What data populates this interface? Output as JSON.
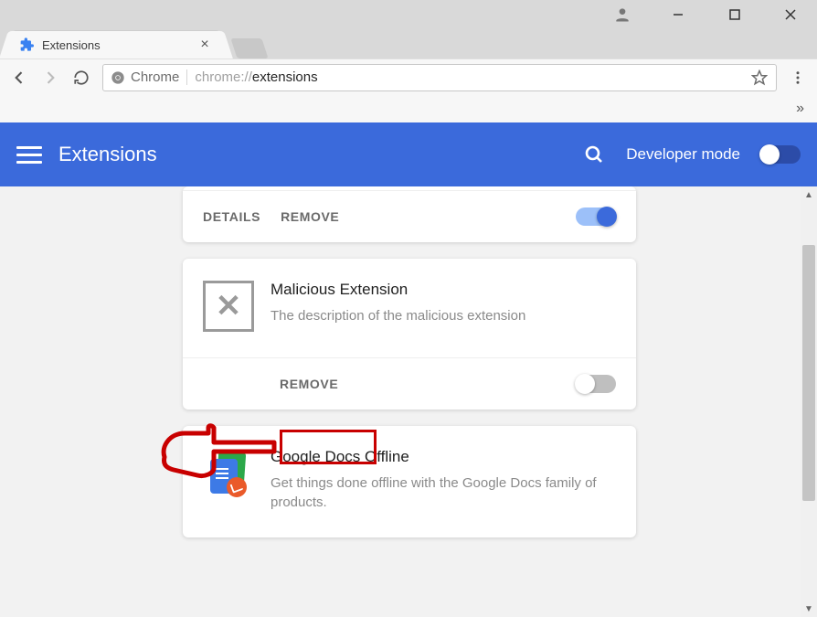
{
  "window": {
    "tab_title": "Extensions"
  },
  "toolbar": {
    "chrome_label": "Chrome",
    "url_prefix": "chrome://",
    "url_emph": "extensions"
  },
  "overflow_chevron": "»",
  "blue_header": {
    "title": "Extensions",
    "dev_mode_label": "Developer mode"
  },
  "cards": [
    {
      "details_label": "DETAILS",
      "remove_label": "REMOVE"
    },
    {
      "title": "Malicious Extension",
      "description": "The description of the malicious extension",
      "remove_label": "REMOVE"
    },
    {
      "title": "Google Docs Offline",
      "description": "Get things done offline with the Google Docs family of products."
    }
  ]
}
